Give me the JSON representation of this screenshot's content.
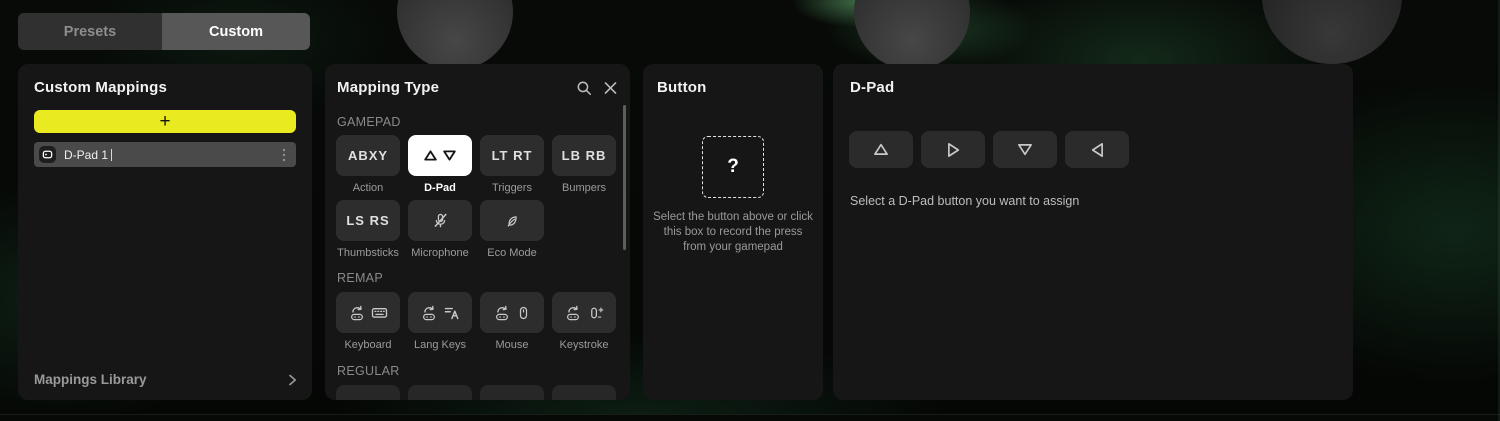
{
  "tabs": {
    "presets": "Presets",
    "custom": "Custom"
  },
  "custom_mappings": {
    "title": "Custom Mappings",
    "add_button": "+",
    "mapping_item": {
      "name": "D-Pad 1"
    },
    "library": "Mappings Library"
  },
  "mapping_type": {
    "title": "Mapping Type",
    "section_gamepad": "GAMEPAD",
    "section_remap": "REMAP",
    "section_regular": "REGULAR",
    "tiles": {
      "action": {
        "text": "ABXY",
        "label": "Action"
      },
      "dpad": {
        "label": "D-Pad"
      },
      "triggers": {
        "text": "LT RT",
        "label": "Triggers"
      },
      "bumpers": {
        "text": "LB RB",
        "label": "Bumpers"
      },
      "thumbsticks": {
        "text": "LS RS",
        "label": "Thumbsticks"
      },
      "microphone": {
        "label": "Microphone"
      },
      "eco": {
        "label": "Eco Mode"
      },
      "keyboard": {
        "label": "Keyboard"
      },
      "lang_keys": {
        "label": "Lang Keys"
      },
      "mouse": {
        "label": "Mouse"
      },
      "keystroke": {
        "label": "Keystroke"
      }
    }
  },
  "button_panel": {
    "title": "Button",
    "placeholder": "?",
    "hint": "Select the button above or click this box to record the press from your gamepad"
  },
  "dpad_panel": {
    "title": "D-Pad",
    "hint": "Select a D-Pad button you want to assign"
  },
  "colors": {
    "accent_yellow": "#e9eb20",
    "selected_tile": "#ffffff",
    "selected_row": "#4a4a4a",
    "panel_bg": "#161616"
  }
}
